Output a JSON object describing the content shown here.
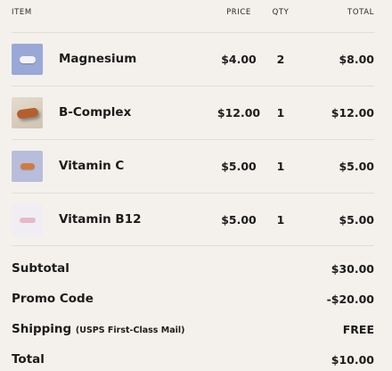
{
  "table_header": {
    "item": "ITEM",
    "price": "PRICE",
    "qty": "QTY",
    "total": "TOTAL"
  },
  "items": [
    {
      "icon": "magnesium-pill-icon",
      "name": "Magnesium",
      "price": "$4.00",
      "qty": "2",
      "total": "$8.00",
      "thumb_bg": "#9aa8d8",
      "pill_color": "#f4f4f6"
    },
    {
      "icon": "b-complex-pill-icon",
      "name": "B-Complex",
      "price": "$12.00",
      "qty": "1",
      "total": "$12.00",
      "thumb_bg": "#d9cfc0",
      "pill_color": "#b35f2e"
    },
    {
      "icon": "vitamin-c-pill-icon",
      "name": "Vitamin C",
      "price": "$5.00",
      "qty": "1",
      "total": "$5.00",
      "thumb_bg": "#b8bddb",
      "pill_color": "#d47a3c"
    },
    {
      "icon": "vitamin-b12-pill-icon",
      "name": "Vitamin B12",
      "price": "$5.00",
      "qty": "1",
      "total": "$5.00",
      "thumb_bg": "#f0eef4",
      "pill_color": "#e7b9c8"
    }
  ],
  "summary": {
    "subtotal_label": "Subtotal",
    "subtotal_value": "$30.00",
    "promo_label": "Promo Code",
    "promo_value": "-$20.00",
    "shipping_label": "Shipping",
    "shipping_note": "(USPS First-Class Mail)",
    "shipping_value": "FREE",
    "total_label": "Total",
    "total_value": "$10.00"
  }
}
